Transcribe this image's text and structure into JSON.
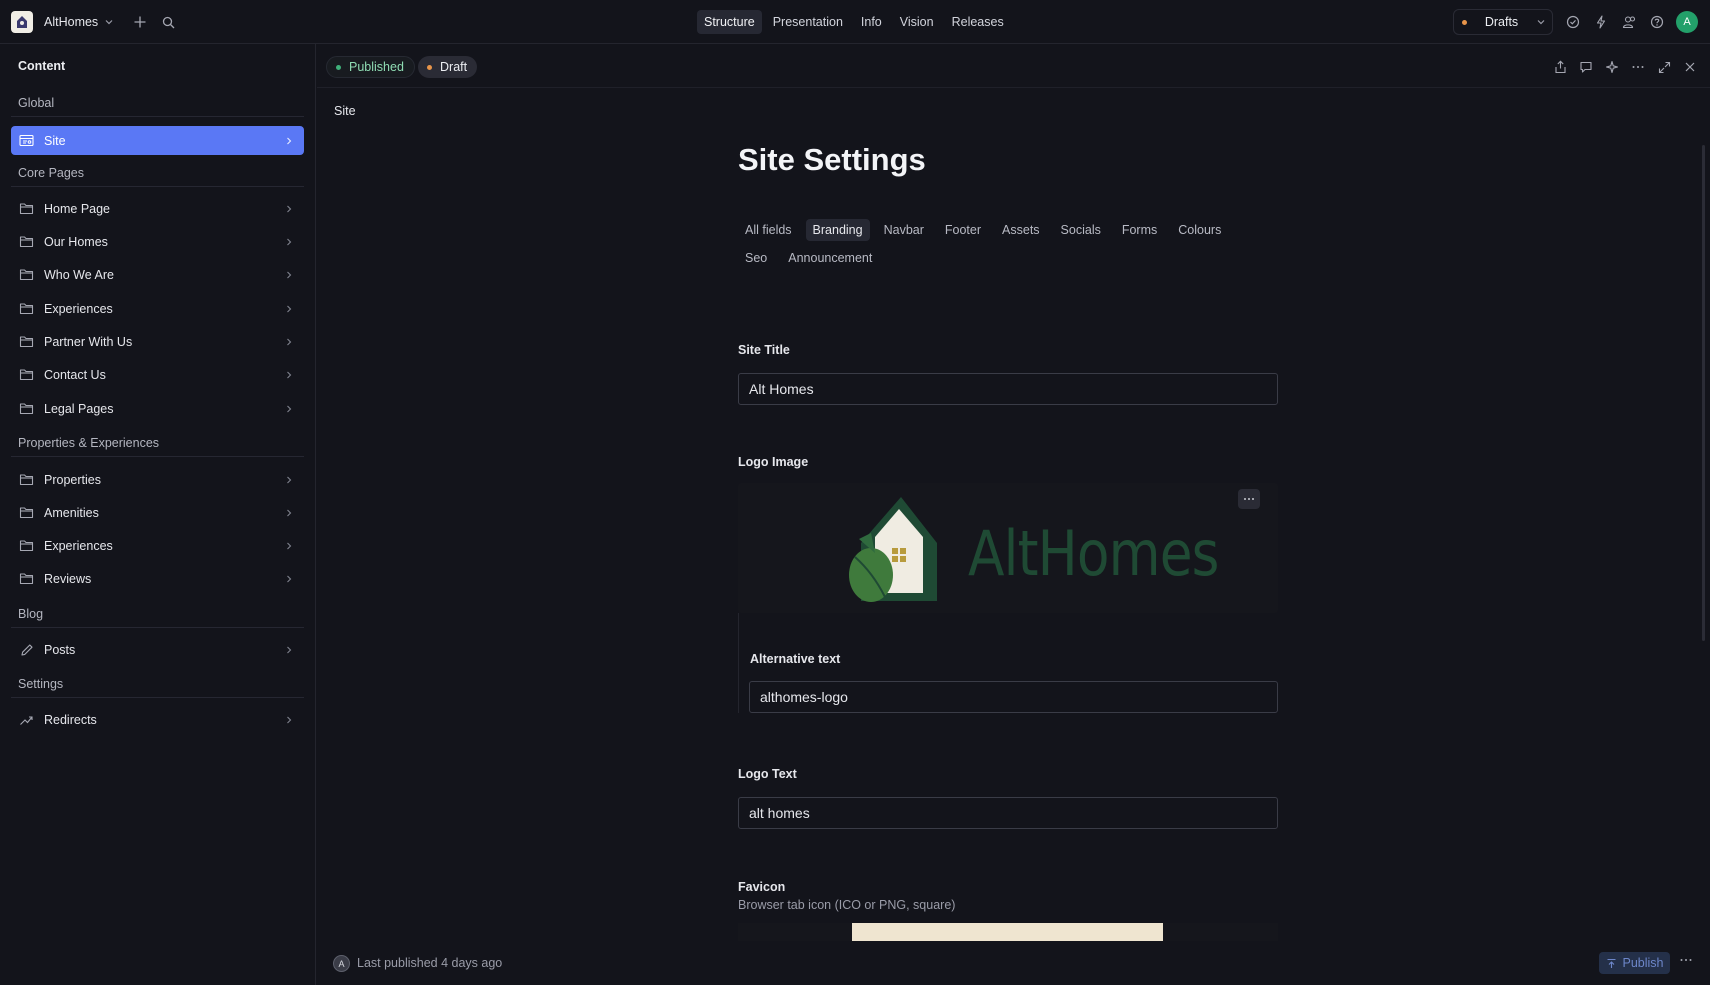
{
  "topbar": {
    "app_name": "AltHomes",
    "tabs": [
      "Structure",
      "Presentation",
      "Info",
      "Vision",
      "Releases"
    ],
    "active_tab": "Structure",
    "perspective_label": "Drafts",
    "user_initial": "A"
  },
  "sidebar": {
    "title": "Content",
    "sections": {
      "global": "Global",
      "core_pages": "Core Pages",
      "properties": "Properties & Experiences",
      "blog": "Blog",
      "settings": "Settings"
    },
    "items": {
      "site": "Site",
      "home_page": "Home Page",
      "our_homes": "Our Homes",
      "who_we_are": "Who We Are",
      "experiences_page": "Experiences",
      "partner": "Partner With Us",
      "contact": "Contact Us",
      "legal": "Legal Pages",
      "properties": "Properties",
      "amenities": "Amenities",
      "experiences": "Experiences",
      "reviews": "Reviews",
      "posts": "Posts",
      "redirects": "Redirects"
    }
  },
  "document": {
    "status_published": "Published",
    "status_draft": "Draft",
    "breadcrumb": "Site",
    "title": "Site Settings",
    "group_tabs": [
      "All fields",
      "Branding",
      "Navbar",
      "Footer",
      "Assets",
      "Socials",
      "Forms",
      "Colours",
      "Seo",
      "Announcement"
    ],
    "active_group": "Branding",
    "fields": {
      "site_title_label": "Site Title",
      "site_title_value": "Alt Homes",
      "logo_image_label": "Logo Image",
      "logo_wordmark": "AltHomes",
      "alt_text_label": "Alternative text",
      "alt_text_value": "althomes-logo",
      "logo_text_label": "Logo Text",
      "logo_text_value": "alt homes",
      "favicon_label": "Favicon",
      "favicon_desc": "Browser tab icon (ICO or PNG, square)"
    }
  },
  "footer": {
    "avatar_initial": "A",
    "status_text": "Last published 4 days ago",
    "publish_label": "Publish"
  },
  "colors": {
    "accent": "#5a78f5",
    "published": "#3fb07a",
    "draft": "#e8954a",
    "logo_green": "#1f4a34"
  }
}
